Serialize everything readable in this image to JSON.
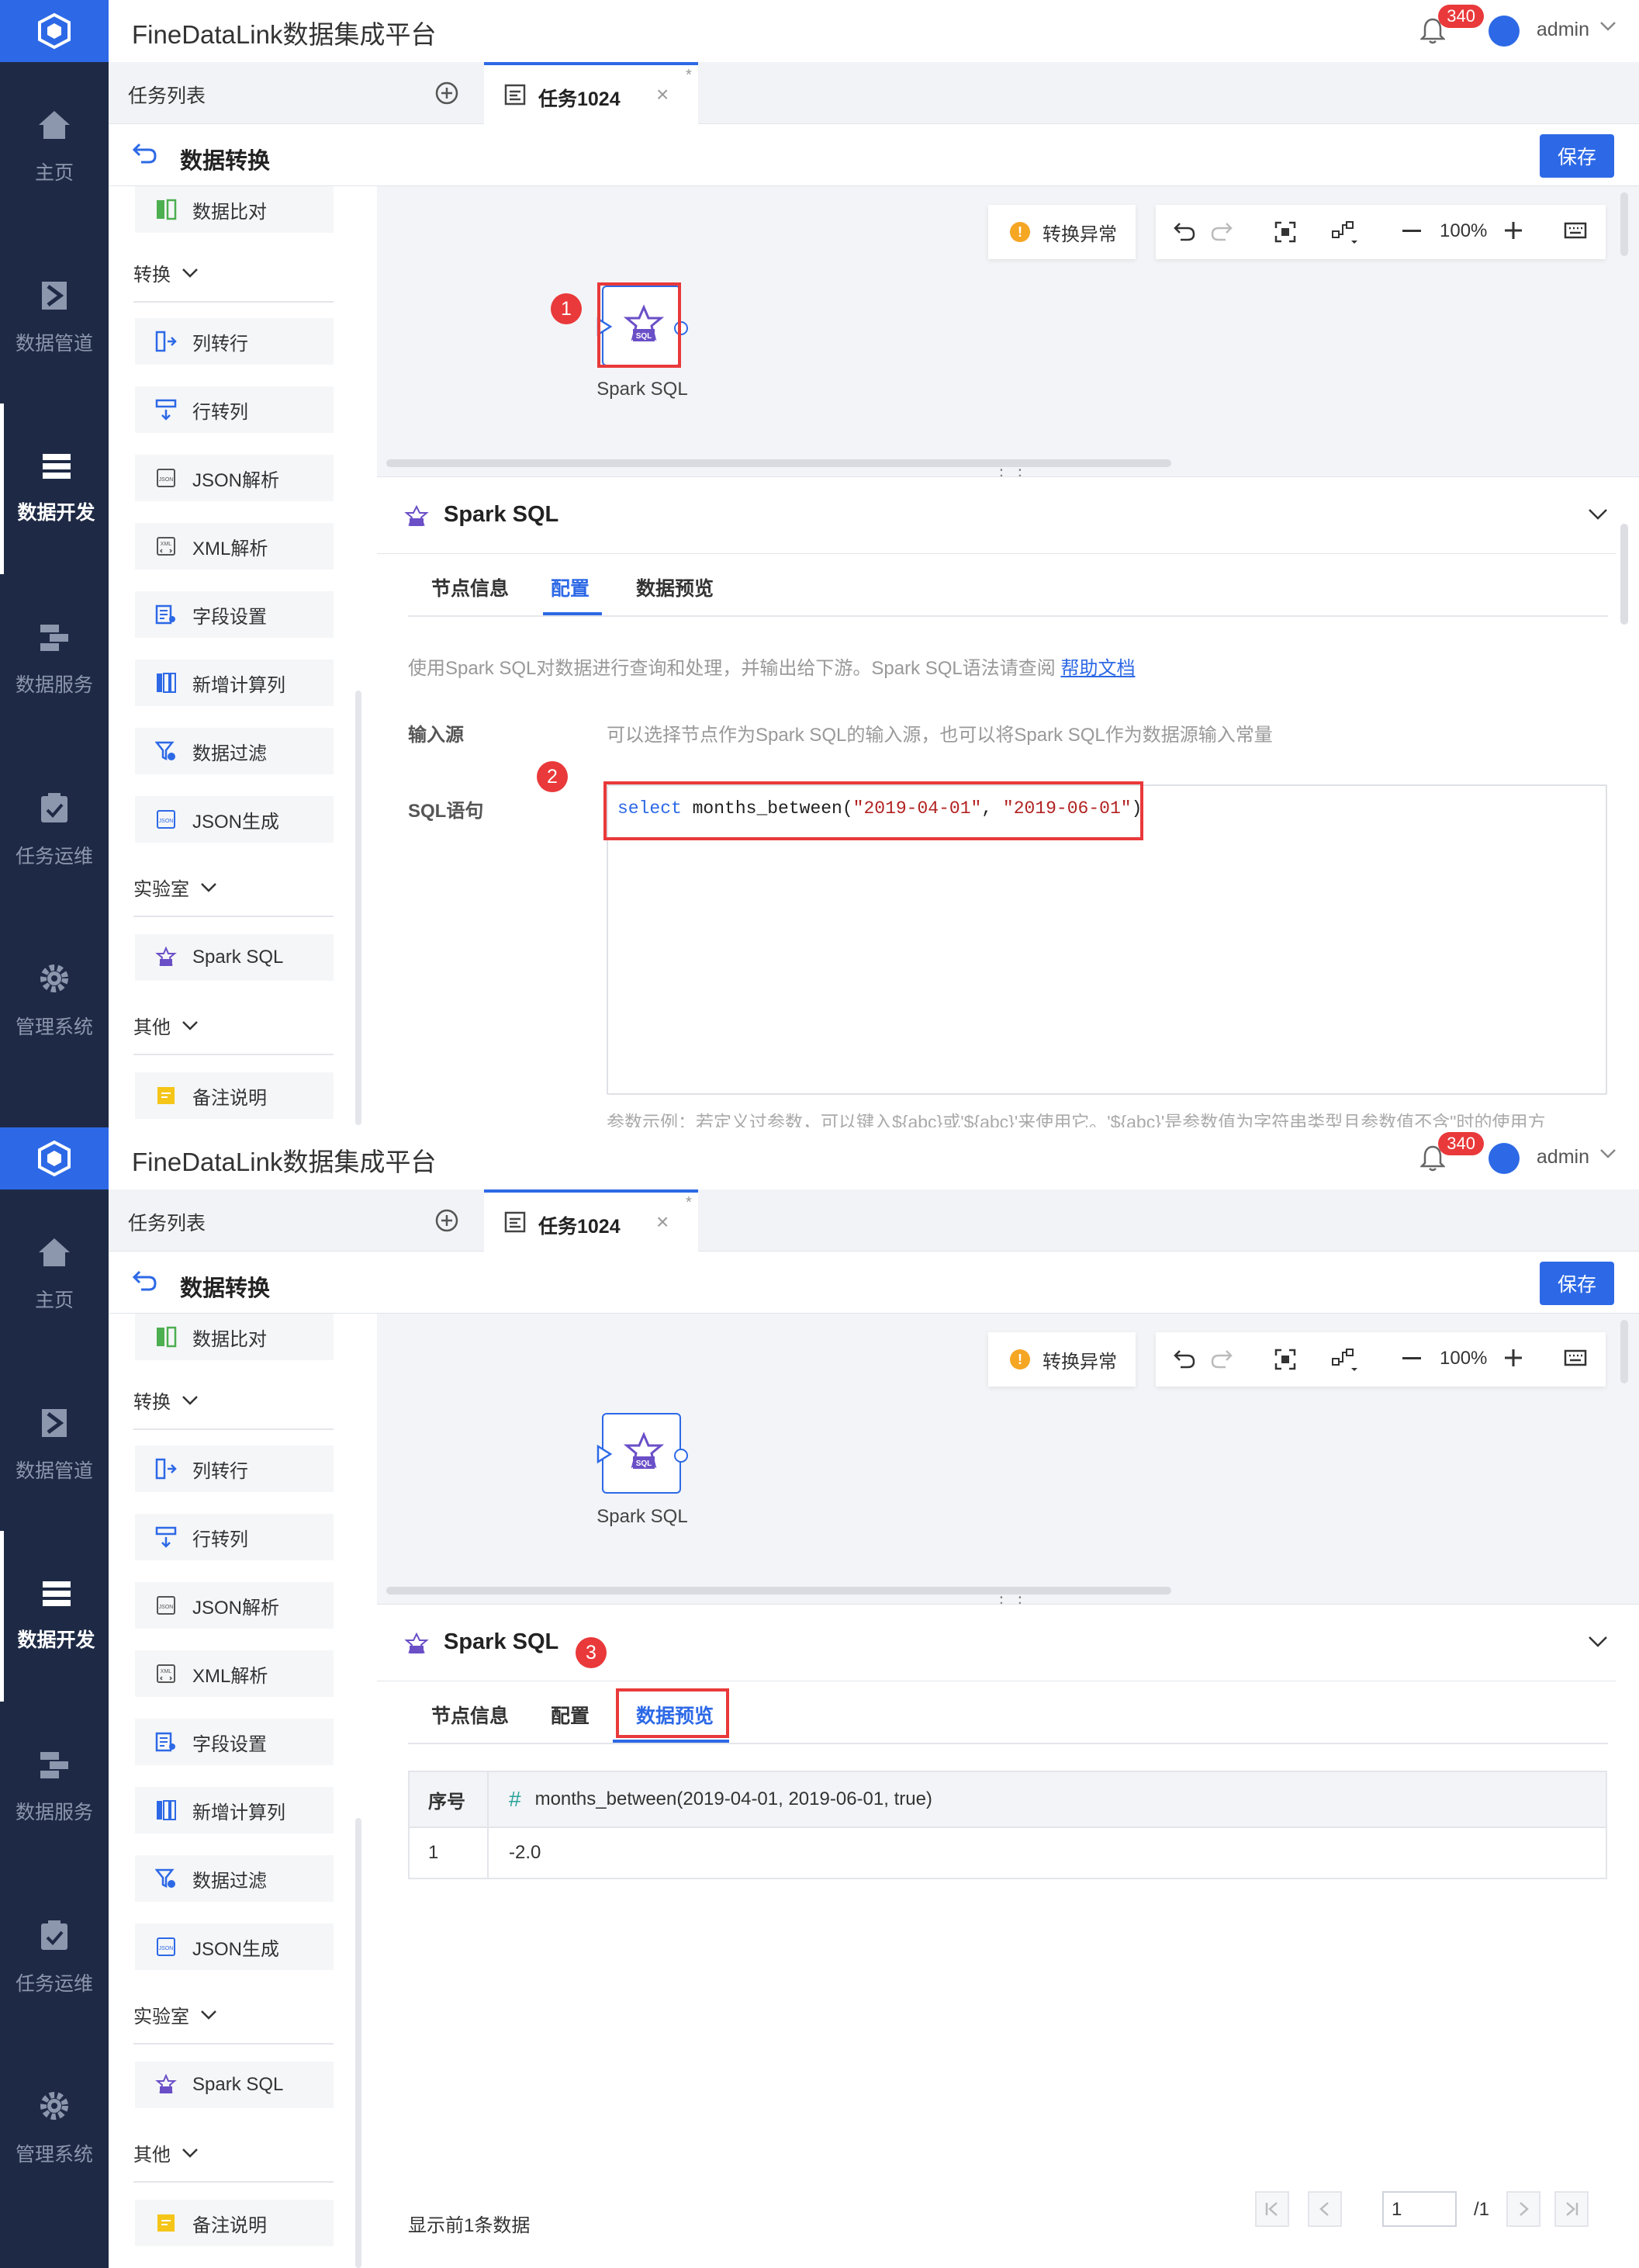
{
  "app": {
    "title": "FineDataLink数据集成平台",
    "notifications": "340",
    "user": "admin"
  },
  "nav": {
    "home": "主页",
    "pipeline": "数据管道",
    "dev": "数据开发",
    "service": "数据服务",
    "ops": "任务运维",
    "admin": "管理系统"
  },
  "tabs": {
    "task_list": "任务列表",
    "active": "任务1024",
    "modified_mark": "*"
  },
  "header": {
    "title": "数据转换",
    "save": "保存"
  },
  "palette": {
    "compare": "数据比对",
    "group_transform": "转换",
    "col_to_row": "列转行",
    "row_to_col": "行转列",
    "json_parse": "JSON解析",
    "xml_parse": "XML解析",
    "field_settings": "字段设置",
    "add_calc_col": "新增计算列",
    "data_filter": "数据过滤",
    "json_gen": "JSON生成",
    "group_lab": "实验室",
    "spark_sql": "Spark SQL",
    "group_other": "其他",
    "note": "备注说明"
  },
  "canvas": {
    "warning": "转换异常",
    "zoom": "100%",
    "node_label": "Spark SQL"
  },
  "markers": {
    "m1": "1",
    "m2": "2",
    "m3": "3"
  },
  "panel": {
    "title": "Spark SQL",
    "tab_info": "节点信息",
    "tab_config": "配置",
    "tab_preview": "数据预览",
    "desc": "使用Spark SQL对数据进行查询和处理，并输出给下游。Spark SQL语法请查阅",
    "help_link": "帮助文档",
    "input_label": "输入源",
    "input_hint": "可以选择节点作为Spark SQL的输入源，也可以将Spark SQL作为数据源输入常量",
    "sql_label": "SQL语句",
    "sql_kw": "select",
    "sql_fn": " months_between(",
    "sql_arg1": "\"2019-04-01\"",
    "sql_sep": ", ",
    "sql_arg2": "\"2019-06-01\"",
    "sql_end": ")",
    "param_hint": "参数示例：若定义过参数，可以键入${abc}或'${abc}'来使用它。'${abc}'是参数值为字符串类型且参数值不含\"时的使用方"
  },
  "preview": {
    "col_index": "序号",
    "col_name": "months_between(2019-04-01, 2019-06-01, true)",
    "rows": [
      {
        "index": "1",
        "value": "-2.0"
      }
    ],
    "footer": "显示前1条数据",
    "page": "1",
    "page_total": "/1"
  },
  "colors": {
    "primary": "#2d69e6",
    "rail": "#1e2a45",
    "highlight": "#e9393a",
    "warning": "#f5a623"
  }
}
